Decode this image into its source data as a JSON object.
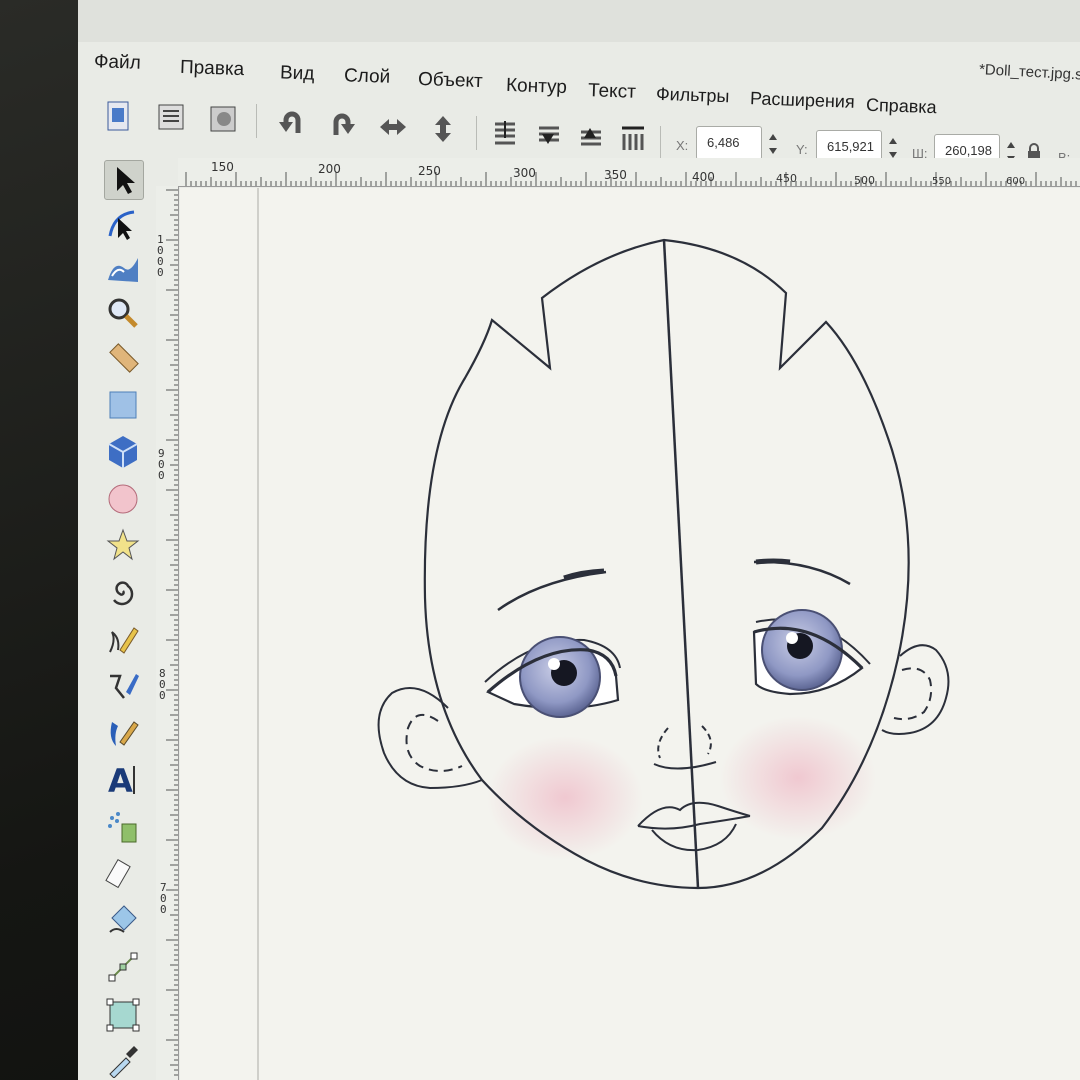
{
  "window": {
    "title": "*Doll_тест.jpg.sv"
  },
  "menu": {
    "items": [
      "Файл",
      "Правка",
      "Вид",
      "Слой",
      "Объект",
      "Контур",
      "Текст",
      "Фильтры",
      "Расширения",
      "Справка"
    ]
  },
  "toolbar": {
    "buttons": [
      "select-all-icon",
      "select-all-layers-icon",
      "deselect-icon",
      "rotate-ccw-icon",
      "rotate-cw-icon",
      "flip-horizontal-icon",
      "flip-vertical-icon",
      "lower-to-bottom-icon",
      "lower-icon",
      "raise-icon",
      "raise-to-top-icon"
    ],
    "x": {
      "label": "X:",
      "value": "6,486"
    },
    "y": {
      "label": "Y:",
      "value": "615,921"
    },
    "w": {
      "label": "Ш:",
      "value": "260,198"
    },
    "h": {
      "label": "В:"
    }
  },
  "ruler": {
    "horizontal": [
      "150",
      "200",
      "250",
      "300",
      "350",
      "400",
      "450",
      "500",
      "550",
      "600"
    ],
    "vertical": [
      "1000",
      "900",
      "800",
      "700"
    ]
  },
  "toolbox": {
    "tools": [
      "selector-tool-icon",
      "node-tool-icon",
      "tweak-tool-icon",
      "zoom-tool-icon",
      "measure-tool-icon",
      "rectangle-tool-icon",
      "3d-box-tool-icon",
      "ellipse-tool-icon",
      "star-tool-icon",
      "spiral-tool-icon",
      "pencil-tool-icon",
      "pen-tool-icon",
      "calligraphy-tool-icon",
      "text-tool-icon",
      "spray-tool-icon",
      "eraser-tool-icon",
      "paint-bucket-tool-icon",
      "gradient-tool-icon",
      "mesh-tool-icon",
      "dropper-tool-icon"
    ],
    "active": "selector-tool-icon"
  },
  "colors": {
    "stroke": "#2b2f3a",
    "iris": "#8f98c4",
    "blush": "#f0c6cf",
    "canvas": "#f3f3ee"
  }
}
